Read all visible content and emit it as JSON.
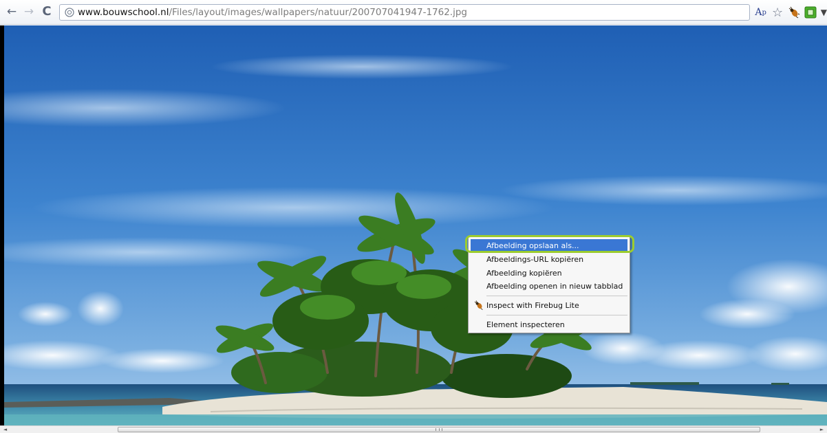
{
  "browser": {
    "nav": {
      "back_glyph": "←",
      "forward_glyph": "→",
      "reload_glyph": "C"
    },
    "url": {
      "host": "www.bouwschool.nl",
      "path": "/Files/layout/images/wallpapers/natuur/200707041947-1762.jpg"
    },
    "extensions": {
      "translate_label": "A",
      "translate_sub": "p",
      "star_glyph": "☆",
      "overflow_glyph": "▼"
    }
  },
  "scrollbar": {
    "left_glyph": "◄",
    "right_glyph": "►"
  },
  "context_menu": {
    "items": [
      {
        "label": "Afbeelding opslaan als...",
        "highlighted": true
      },
      {
        "label": "Afbeeldings-URL kopiëren"
      },
      {
        "label": "Afbeelding kopiëren"
      },
      {
        "label": "Afbeelding openen in nieuw tabblad"
      },
      {
        "label": "Inspect with Firebug Lite",
        "icon": "firebug-icon"
      },
      {
        "label": "Element inspecteren"
      }
    ],
    "highlight_color": "#3a77d4",
    "callout_color": "#9ccc2e"
  }
}
